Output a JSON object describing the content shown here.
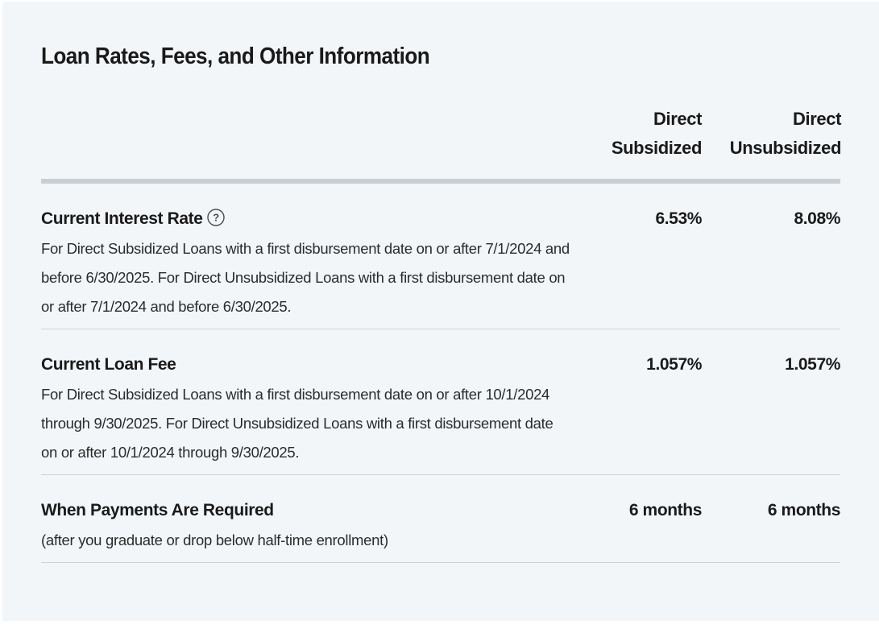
{
  "title": "Loan Rates, Fees, and Other Information",
  "columns": {
    "subsidized": [
      "Direct",
      "Subsidized"
    ],
    "unsubsidized": [
      "Direct",
      "Unsubsidized"
    ]
  },
  "rows": [
    {
      "label": "Current Interest Rate",
      "has_help_icon": true,
      "description": "For Direct Subsidized Loans with a first disbursement date on or after 7/1/2024 and before 6/30/2025. For Direct Unsubsidized Loans with a first disbursement date on or after 7/1/2024 and before 6/30/2025.",
      "subsidized": "6.53%",
      "unsubsidized": "8.08%"
    },
    {
      "label": "Current Loan Fee",
      "description": "For Direct Subsidized Loans with a first disbursement date on or after 10/1/2024 through 9/30/2025. For Direct Unsubsidized Loans with a first disbursement date on or after 10/1/2024 through 9/30/2025.",
      "subsidized": "1.057%",
      "unsubsidized": "1.057%"
    },
    {
      "label": "When Payments Are Required",
      "description": "(after you graduate or drop below half-time enrollment)",
      "subsidized": "6 months",
      "unsubsidized": "6 months"
    }
  ],
  "colors": {
    "card_background": "#f3f6f9",
    "text": "#1a1a1a",
    "header_rule": "#c9ced3",
    "row_divider": "#cdd1d5"
  },
  "icons": {
    "help": "question-circle-icon"
  }
}
